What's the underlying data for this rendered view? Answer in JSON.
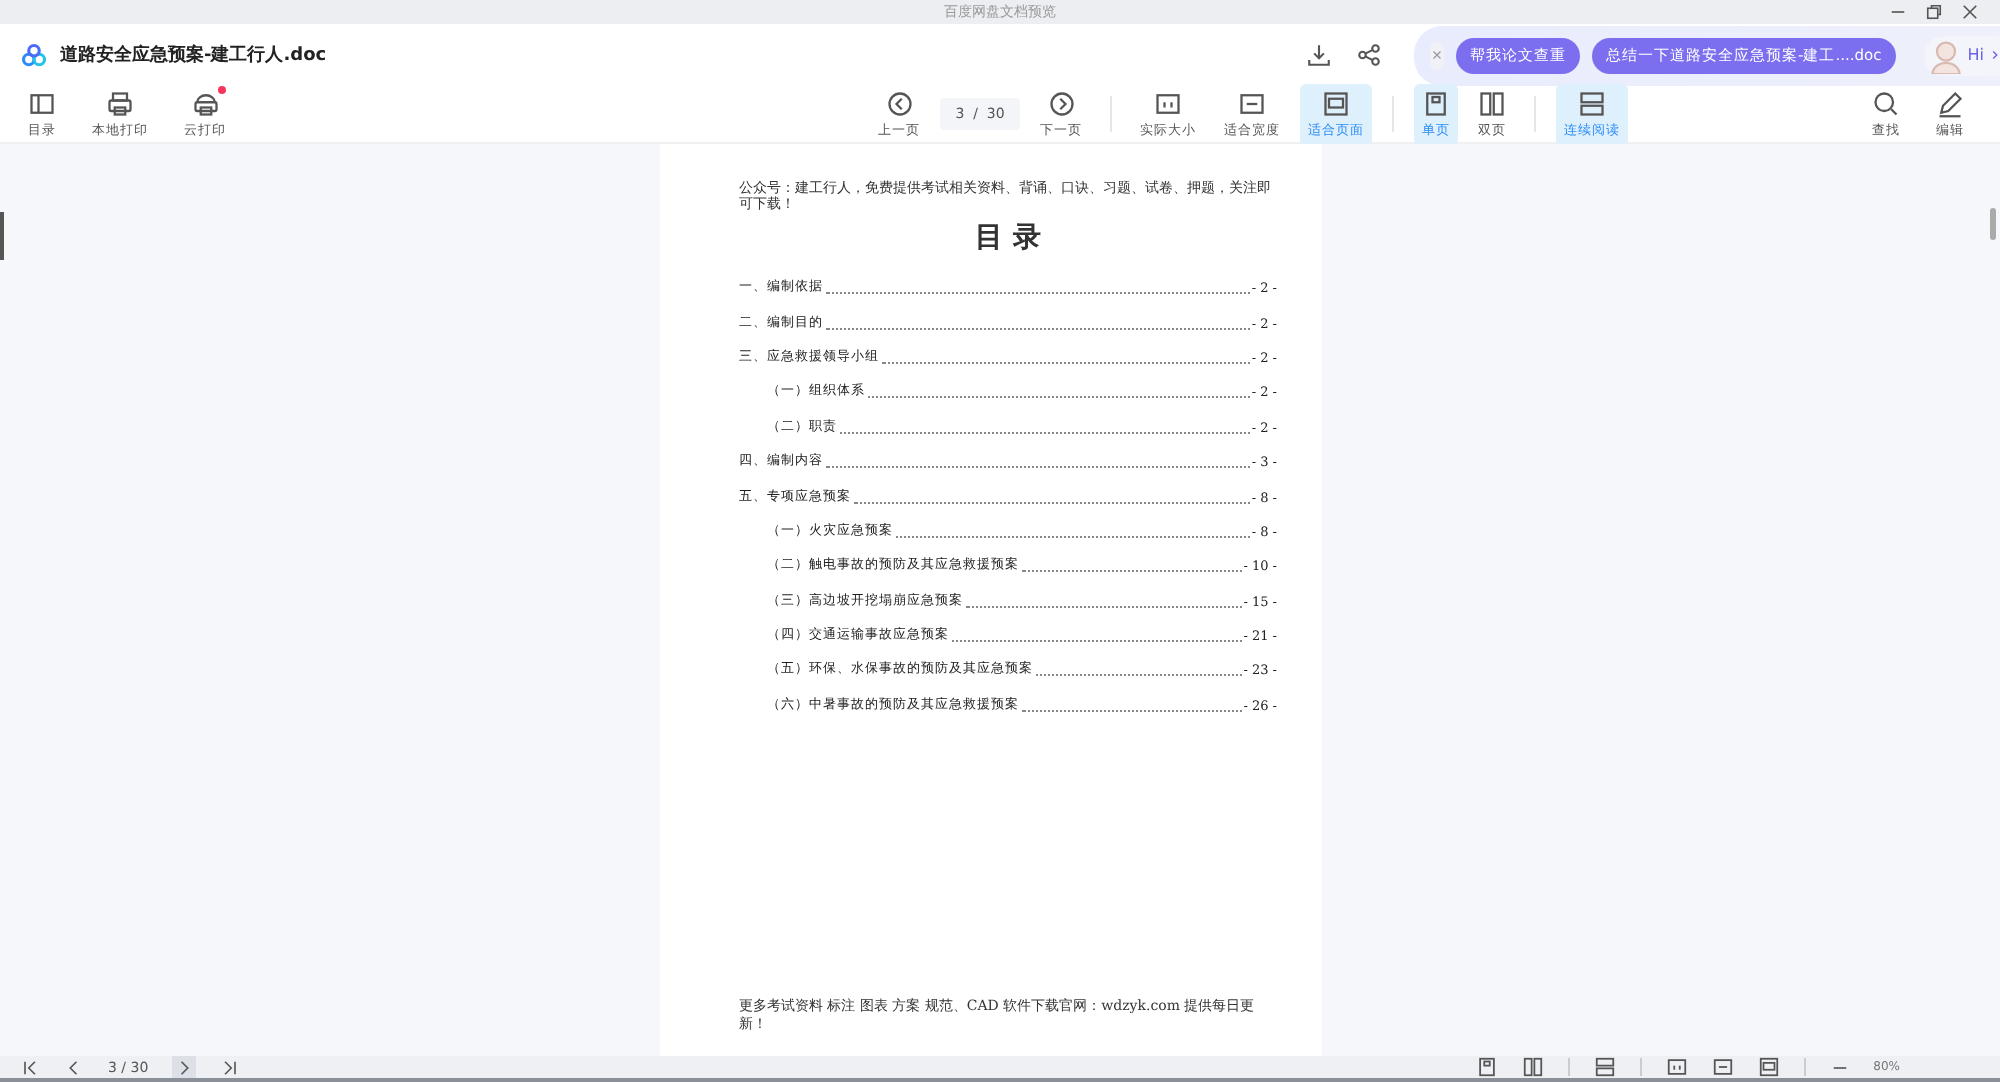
{
  "window": {
    "title": "百度网盘文档预览"
  },
  "header": {
    "filename": "道路安全应急预案-建工行人.doc",
    "ai_chips": [
      "帮我论文查重",
      "总结一下道路安全应急预案-建工....doc"
    ],
    "greeting": "Hi"
  },
  "toolbar": {
    "left": [
      {
        "label": "目录",
        "badge": false
      },
      {
        "label": "本地打印",
        "badge": false
      },
      {
        "label": "云打印",
        "badge": true
      }
    ],
    "page_input": "3  /  30",
    "prev": "上一页",
    "next": "下一页",
    "views": [
      {
        "label": "实际大小",
        "selected": false
      },
      {
        "label": "适合宽度",
        "selected": false
      },
      {
        "label": "适合页面",
        "selected": true
      },
      {
        "label": "单页",
        "selected": true
      },
      {
        "label": "双页",
        "selected": false
      },
      {
        "label": "连续阅读",
        "selected": true
      }
    ],
    "right": [
      {
        "label": "查找"
      },
      {
        "label": "编辑"
      }
    ]
  },
  "document": {
    "header_note": "公众号：建工行人，免费提供考试相关资料、背诵、口诀、习题、试卷、押题，关注即可下载！",
    "title": "目 录",
    "toc": [
      {
        "text": "一、编制依据",
        "page": "- 2 -"
      },
      {
        "text": "二、编制目的",
        "page": "- 2 -"
      },
      {
        "text": "三、应急救援领导小组",
        "page": "- 2 -",
        "children": [
          {
            "text": "（一）组织体系",
            "page": "- 2 -"
          },
          {
            "text": "（二）职责",
            "page": "- 2 -"
          }
        ]
      },
      {
        "text": "四、编制内容",
        "page": "- 3 -"
      },
      {
        "text": "五、专项应急预案",
        "page": "- 8 -",
        "children": [
          {
            "text": "（一）火灾应急预案",
            "page": "- 8 -"
          },
          {
            "text": "（二）触电事故的预防及其应急救援预案",
            "page": "- 10 -"
          },
          {
            "text": "（三）高边坡开挖塌崩应急预案",
            "page": "- 15 -"
          },
          {
            "text": "（四）交通运输事故应急预案",
            "page": "- 21 -"
          },
          {
            "text": "（五）环保、水保事故的预防及其应急预案",
            "page": "- 23 -"
          },
          {
            "text": "（六）中暑事故的预防及其应急救援预案",
            "page": "- 26 -"
          }
        ]
      }
    ],
    "footer_note": "更多考试资料 标注 图表 方案 规范、CAD 软件下载官网：wdzyk.com 提供每日更新！"
  },
  "bottom_bar": {
    "page_input": "3  /  30",
    "zoom": "80%"
  }
}
